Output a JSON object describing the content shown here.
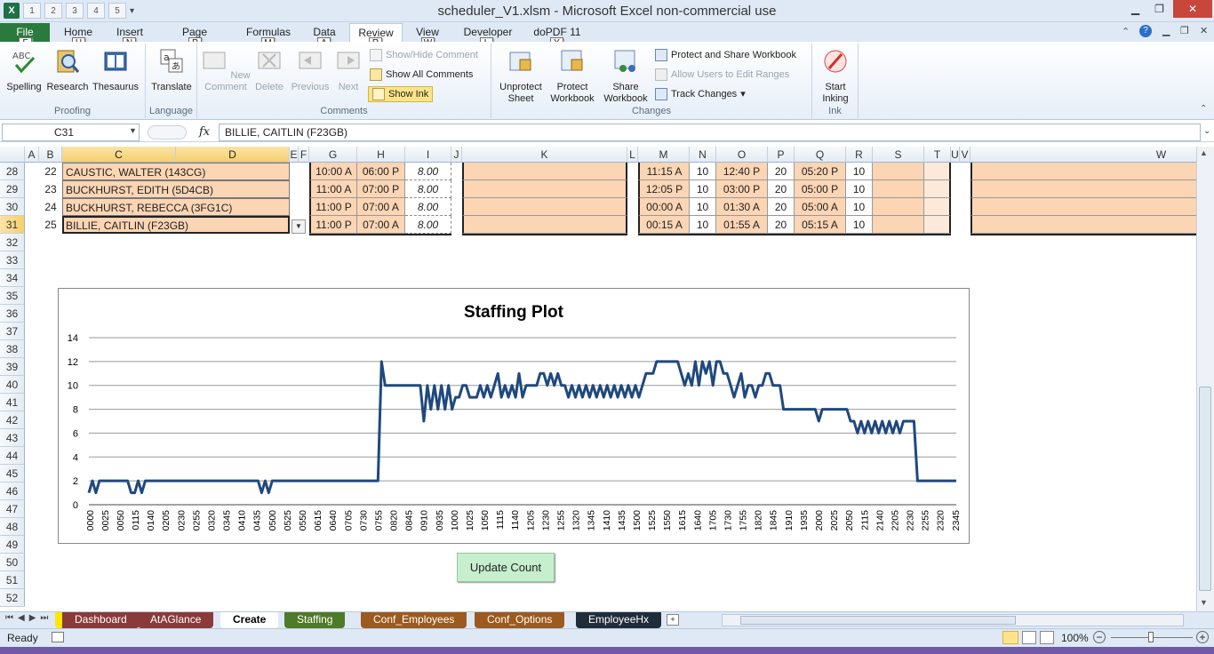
{
  "window": {
    "title": "scheduler_V1.xlsm  -  Microsoft Excel non-commercial use"
  },
  "qat": {
    "keytips": [
      "1",
      "2",
      "3",
      "4",
      "5"
    ]
  },
  "tabs": [
    {
      "label": "File",
      "key": "F"
    },
    {
      "label": "Home",
      "key": "H"
    },
    {
      "label": "Insert",
      "key": "N"
    },
    {
      "label": "Page Layout",
      "key": "P"
    },
    {
      "label": "Formulas",
      "key": "M"
    },
    {
      "label": "Data",
      "key": "A"
    },
    {
      "label": "Review",
      "key": "R"
    },
    {
      "label": "View",
      "key": "W"
    },
    {
      "label": "Developer",
      "key": "L"
    },
    {
      "label": "doPDF 11",
      "key": "Y"
    }
  ],
  "ribbon": {
    "proofing": {
      "label": "Proofing",
      "spelling": "Spelling",
      "research": "Research",
      "thesaurus": "Thesaurus"
    },
    "language": {
      "label": "Language",
      "translate": "Translate"
    },
    "comments": {
      "label": "Comments",
      "new_comment": "New Comment",
      "delete": "Delete",
      "previous": "Previous",
      "next": "Next",
      "show_hide": "Show/Hide Comment",
      "show_all": "Show All Comments",
      "show_ink": "Show Ink"
    },
    "changes": {
      "label": "Changes",
      "unprotect_sheet": "Unprotect Sheet",
      "protect_workbook": "Protect Workbook",
      "share_workbook": "Share Workbook",
      "protect_share": "Protect and Share Workbook",
      "allow_users": "Allow Users to Edit Ranges",
      "track_changes": "Track Changes"
    },
    "ink": {
      "label": "Ink",
      "start_inking": "Start Inking"
    }
  },
  "formula_bar": {
    "name_box": "C31",
    "fx": "fx",
    "content": "BILLIE, CAITLIN (F23GB)"
  },
  "columns": [
    "A",
    "B",
    "C",
    "D",
    "E",
    "F",
    "G",
    "H",
    "I",
    "J",
    "K",
    "L",
    "M",
    "N",
    "O",
    "P",
    "Q",
    "R",
    "S",
    "T",
    "U",
    "V",
    "W"
  ],
  "row_numbers": [
    "28",
    "29",
    "30",
    "31",
    "32",
    "33",
    "34",
    "35",
    "36",
    "37",
    "38",
    "39",
    "40",
    "41",
    "42",
    "43",
    "44",
    "45",
    "46",
    "47",
    "48",
    "49",
    "50",
    "51",
    "52"
  ],
  "rows": [
    {
      "b": "22",
      "name": "CAUSTIC, WALTER (143CG)",
      "g": "10:00 A",
      "h": "06:00 P",
      "i": "8.00",
      "m": "11:15 A",
      "n": "10",
      "o": "12:40 P",
      "p": "20",
      "q": "05:20 P",
      "r": "10"
    },
    {
      "b": "23",
      "name": "BUCKHURST, EDITH (5D4CB)",
      "g": "11:00 A",
      "h": "07:00 P",
      "i": "8.00",
      "m": "12:05 P",
      "n": "10",
      "o": "03:00 P",
      "p": "20",
      "q": "05:00 P",
      "r": "10"
    },
    {
      "b": "24",
      "name": "BUCKHURST, REBECCA (3FG1C)",
      "g": "11:00 P",
      "h": "07:00 A",
      "i": "8.00",
      "m": "00:00 A",
      "n": "10",
      "o": "01:30 A",
      "p": "20",
      "q": "05:00 A",
      "r": "10"
    },
    {
      "b": "25",
      "name": "BILLIE, CAITLIN (F23GB)",
      "g": "11:00 P",
      "h": "07:00 A",
      "i": "8.00",
      "m": "00:15 A",
      "n": "10",
      "o": "01:55 A",
      "p": "20",
      "q": "05:15 A",
      "r": "10"
    }
  ],
  "update_button": "Update Count",
  "sheet_tabs": [
    {
      "label": "Dashboard",
      "color": "#8b3a3a"
    },
    {
      "label": "AtAGlance",
      "color": "#8b3a3a"
    },
    {
      "label": "Create",
      "color": "#ffffff"
    },
    {
      "label": "Staffing",
      "color": "#4f7a28"
    },
    {
      "label": "Conf_Employees",
      "color": "#9c5a1e"
    },
    {
      "label": "Conf_Options",
      "color": "#9c5a1e"
    },
    {
      "label": "EmployeeHx",
      "color": "#1f2d3a"
    }
  ],
  "status": {
    "ready": "Ready",
    "zoom": "100%"
  },
  "chart_data": {
    "type": "line",
    "title": "Staffing Plot",
    "ylim": [
      0,
      14
    ],
    "yticks": [
      0,
      2,
      4,
      6,
      8,
      10,
      12,
      14
    ],
    "xtick_labels": [
      "0000",
      "0025",
      "0050",
      "0115",
      "0140",
      "0205",
      "0230",
      "0255",
      "0320",
      "0345",
      "0410",
      "0435",
      "0500",
      "0525",
      "0550",
      "0615",
      "0640",
      "0705",
      "0730",
      "0755",
      "0820",
      "0845",
      "0910",
      "0935",
      "1000",
      "1025",
      "1050",
      "1115",
      "1140",
      "1205",
      "1230",
      "1255",
      "1320",
      "1345",
      "1410",
      "1435",
      "1500",
      "1525",
      "1550",
      "1615",
      "1640",
      "1705",
      "1730",
      "1755",
      "1820",
      "1845",
      "1910",
      "1935",
      "2000",
      "2025",
      "2050",
      "2115",
      "2140",
      "2205",
      "2230",
      "2255",
      "2320",
      "2345"
    ],
    "series": [
      {
        "values": [
          1,
          2,
          1,
          2,
          2,
          2,
          2,
          2,
          2,
          2,
          2,
          2,
          1,
          1,
          2,
          1,
          2,
          2,
          2,
          2,
          2,
          2,
          2,
          2,
          2,
          2,
          2,
          2,
          2,
          2,
          2,
          2,
          2,
          2,
          2,
          2,
          2,
          2,
          2,
          2,
          2,
          2,
          2,
          2,
          2,
          2,
          2,
          2,
          2,
          1,
          2,
          1,
          2,
          2,
          2,
          2,
          2,
          2,
          2,
          2,
          2,
          2,
          2,
          2,
          2,
          2,
          2,
          2,
          2,
          2,
          2,
          2,
          2,
          2,
          2,
          2,
          2,
          2,
          2,
          2,
          2,
          2,
          2,
          12,
          10,
          10,
          10,
          10,
          10,
          10,
          10,
          10,
          10,
          10,
          10,
          7,
          10,
          8,
          10,
          8,
          10,
          8,
          10,
          8,
          9,
          9,
          10,
          10,
          9,
          9,
          9,
          10,
          9,
          10,
          9,
          10,
          11,
          9,
          10,
          9,
          10,
          9,
          11,
          9,
          10,
          10,
          10,
          10,
          11,
          11,
          10,
          11,
          10,
          11,
          10,
          10,
          9,
          10,
          9,
          10,
          9,
          10,
          9,
          10,
          9,
          10,
          9,
          10,
          9,
          10,
          9,
          10,
          9,
          10,
          9,
          10,
          9,
          10,
          11,
          11,
          11,
          12,
          12,
          12,
          12,
          12,
          12,
          12,
          11,
          10,
          11,
          10,
          12,
          10,
          12,
          11,
          12,
          10,
          12,
          12,
          11,
          11,
          10,
          9,
          10,
          11,
          9,
          10,
          10,
          9,
          10,
          10,
          11,
          11,
          10,
          10,
          10,
          8,
          8,
          8,
          8,
          8,
          8,
          8,
          8,
          8,
          8,
          7,
          8,
          8,
          8,
          8,
          8,
          8,
          8,
          8,
          7,
          7,
          6,
          7,
          6,
          7,
          6,
          7,
          6,
          7,
          6,
          7,
          6,
          7,
          6,
          7,
          7,
          7,
          7,
          2,
          2,
          2,
          2,
          2,
          2,
          2,
          2,
          2,
          2,
          2,
          2
        ],
        "color": "#1f497d"
      }
    ]
  }
}
